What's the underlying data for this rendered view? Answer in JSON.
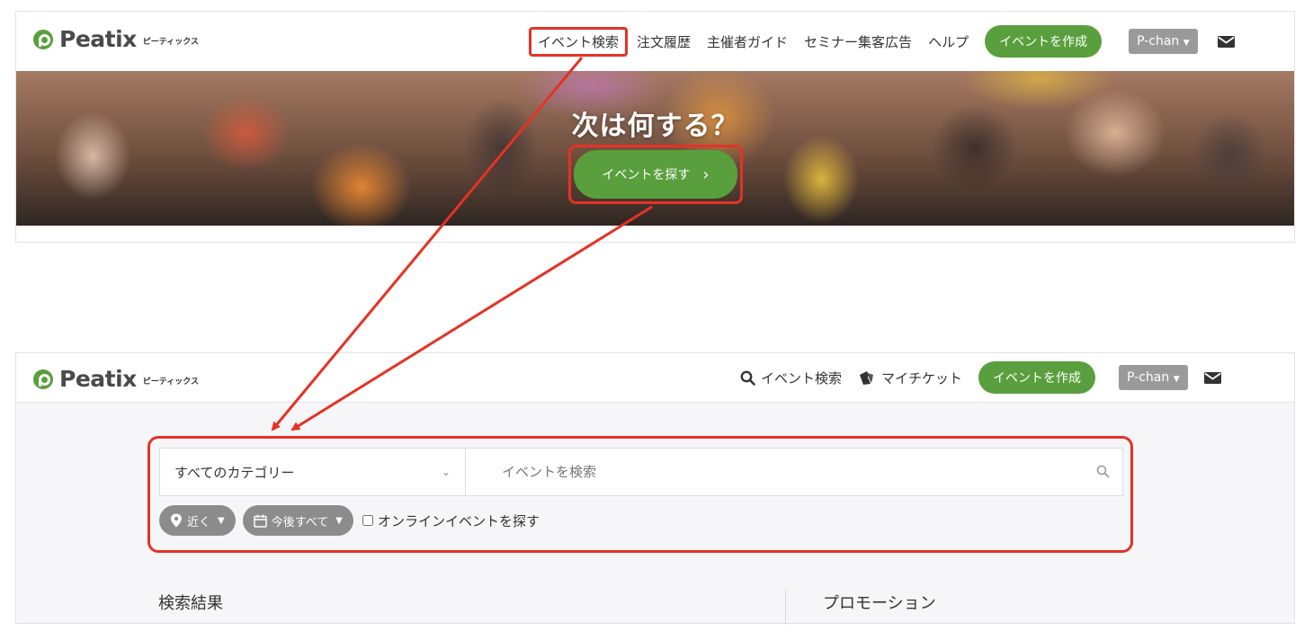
{
  "brand": {
    "logo_text": "Peatix",
    "logo_sub": "ピーティックス"
  },
  "top_screen": {
    "nav": {
      "event_search": "イベント検索",
      "order_history": "注文履歴",
      "organizer_guide": "主催者ガイド",
      "seminar_ads": "セミナー集客広告",
      "help": "ヘルプ",
      "create_event": "イベントを作成",
      "user": "P-chan"
    },
    "hero": {
      "title": "次は何する？",
      "button": "イベントを探す"
    }
  },
  "bottom_screen": {
    "nav": {
      "event_search": "イベント検索",
      "my_tickets": "マイチケット",
      "create_event": "イベントを作成",
      "user": "P-chan"
    },
    "search": {
      "category": "すべてのカテゴリー",
      "placeholder": "イベントを検索",
      "location_filter": "近く",
      "date_filter": "今後すべて",
      "online_label": "オンラインイベントを探す"
    },
    "results_title": "検索結果",
    "promotion_title": "プロモーション"
  },
  "colors": {
    "brand_green": "#5a9f3d",
    "annotation_red": "#e53224",
    "user_gray": "#9a9a9a"
  }
}
